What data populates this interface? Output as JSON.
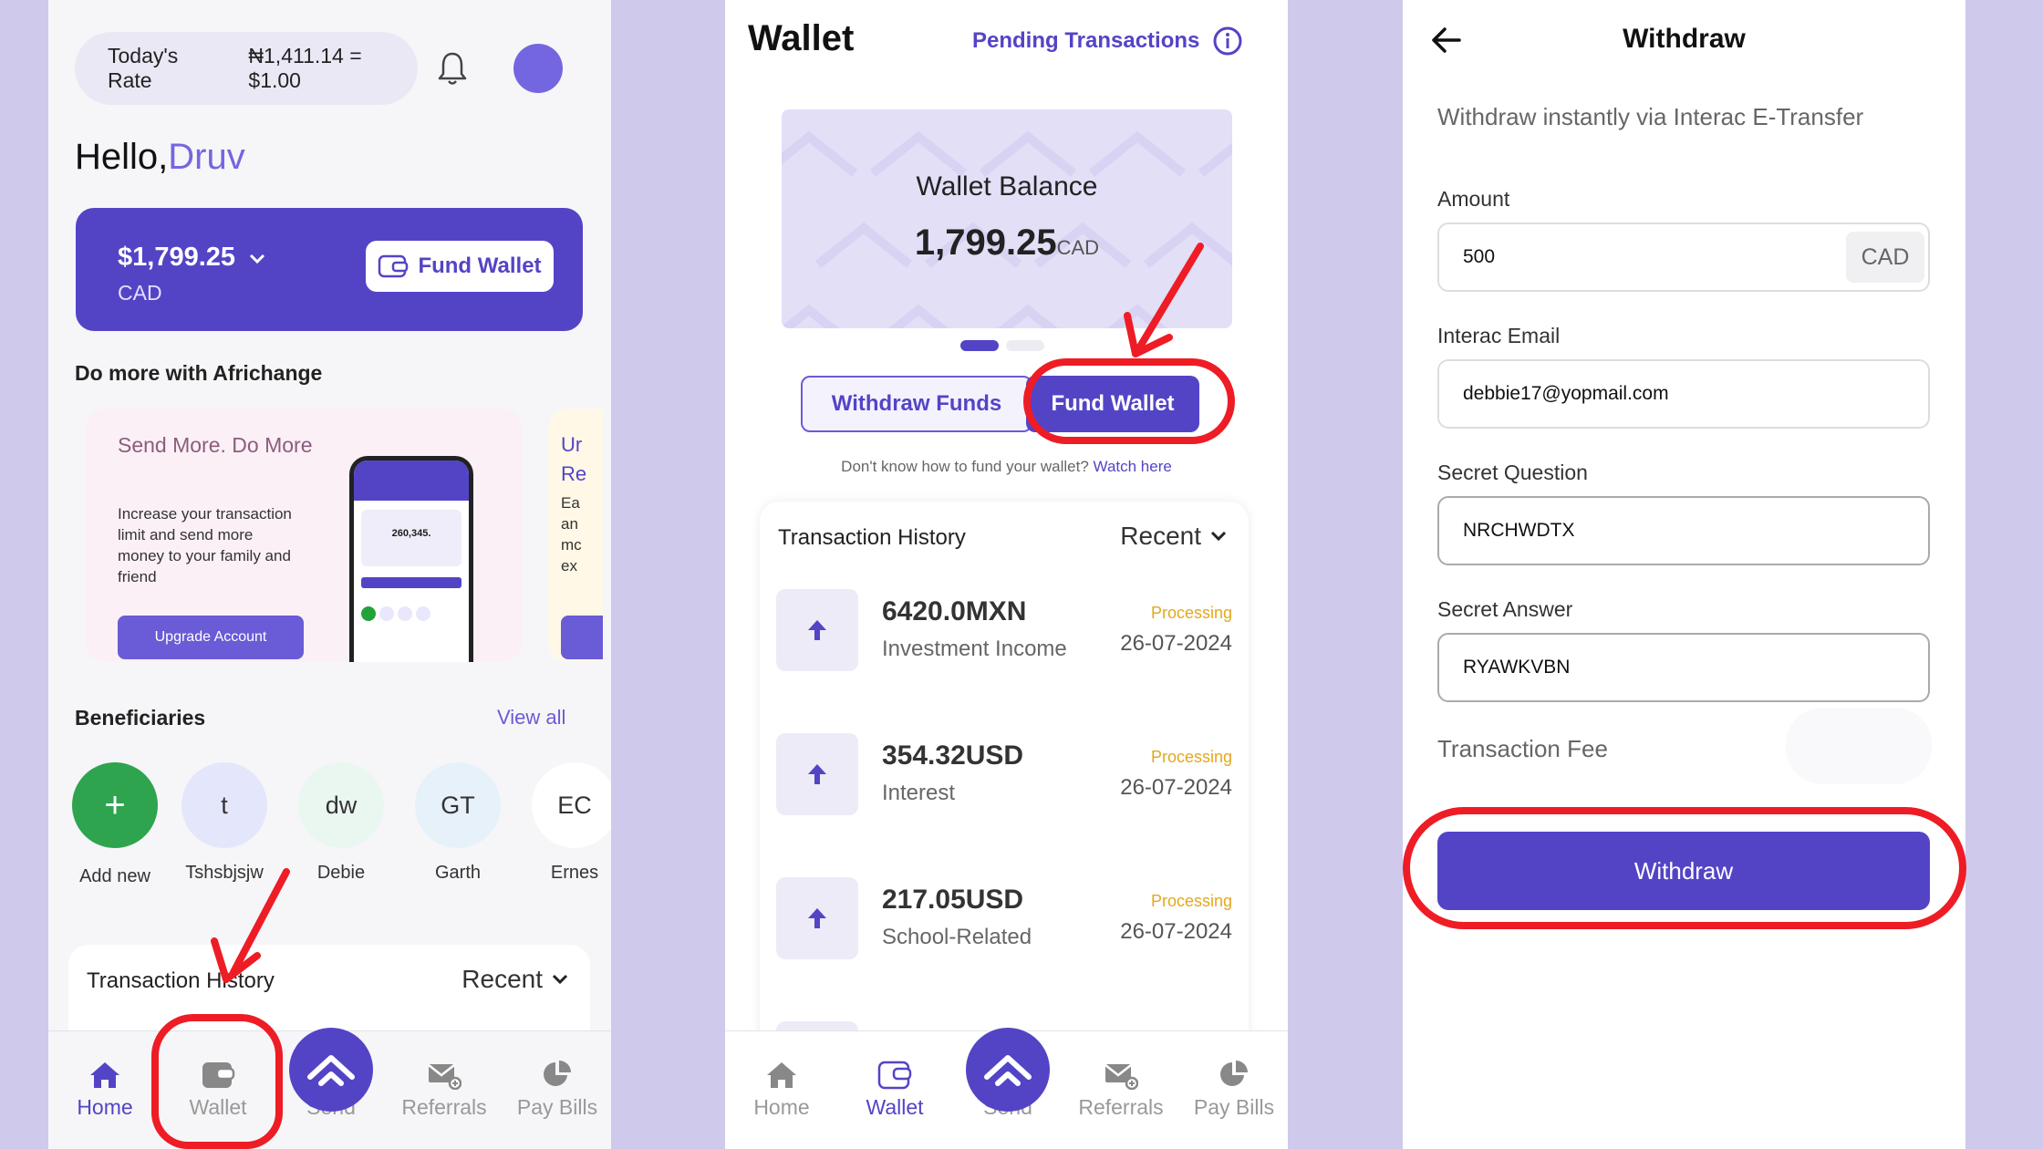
{
  "colors": {
    "primary": "#5344c6",
    "accent": "#7466e0",
    "annotation": "#ee1c25",
    "processing": "#e3a81a",
    "background": "#cfc9ec"
  },
  "home": {
    "rate_label": "Today's Rate",
    "rate_value": "₦1,411.14 = $1.00",
    "greeting": "Hello,",
    "user_name": "Druv",
    "balance_amount": "$1,799.25",
    "balance_currency": "CAD",
    "fund_wallet_label": "Fund Wallet",
    "do_more_title": "Do more with Africhange",
    "promo": {
      "heading": "Send More. Do More",
      "body": "Increase your transaction limit and send more money to your family and friend",
      "button": "Upgrade Account",
      "mock_balance": "260,345.",
      "next_card_clip": [
        "Ur",
        "Re",
        "Ea",
        "an",
        "mc",
        "ex"
      ]
    },
    "beneficiaries_title": "Beneficiaries",
    "view_all": "View all",
    "beneficiaries": [
      {
        "initials": "+",
        "name": "Add new"
      },
      {
        "initials": "t",
        "name": "Tshsbjsjw"
      },
      {
        "initials": "dw",
        "name": "Debie"
      },
      {
        "initials": "GT",
        "name": "Garth"
      },
      {
        "initials": "EC",
        "name": "Ernes"
      }
    ],
    "transaction_history": "Transaction History",
    "recent": "Recent"
  },
  "nav": {
    "home": "Home",
    "wallet": "Wallet",
    "send": "Send",
    "referrals": "Referrals",
    "pay_bills": "Pay Bills"
  },
  "wallet": {
    "title": "Wallet",
    "pending": "Pending Transactions",
    "balance_label": "Wallet Balance",
    "balance_amount": "1,799.25",
    "balance_currency": "CAD",
    "withdraw_funds": "Withdraw Funds",
    "fund_wallet": "Fund Wallet",
    "help_text": "Don't know how to fund your wallet?",
    "help_link": "Watch here",
    "transaction_history": "Transaction History",
    "recent": "Recent",
    "transactions": [
      {
        "amount": "6420.0MXN",
        "category": "Investment Income",
        "status": "Processing",
        "date": "26-07-2024"
      },
      {
        "amount": "354.32USD",
        "category": "Interest",
        "status": "Processing",
        "date": "26-07-2024"
      },
      {
        "amount": "217.05USD",
        "category": "School-Related",
        "status": "Processing",
        "date": "26-07-2024"
      }
    ]
  },
  "withdraw": {
    "title": "Withdraw",
    "subtitle": "Withdraw instantly via Interac E-Transfer",
    "amount_label": "Amount",
    "amount_value": "500",
    "amount_currency": "CAD",
    "email_label": "Interac Email",
    "email_value": "debbie17@yopmail.com",
    "question_label": "Secret Question",
    "question_value": "NRCHWDTX",
    "answer_label": "Secret Answer",
    "answer_value": "RYAWKVBN",
    "fee_label": "Transaction Fee",
    "button": "Withdraw"
  }
}
